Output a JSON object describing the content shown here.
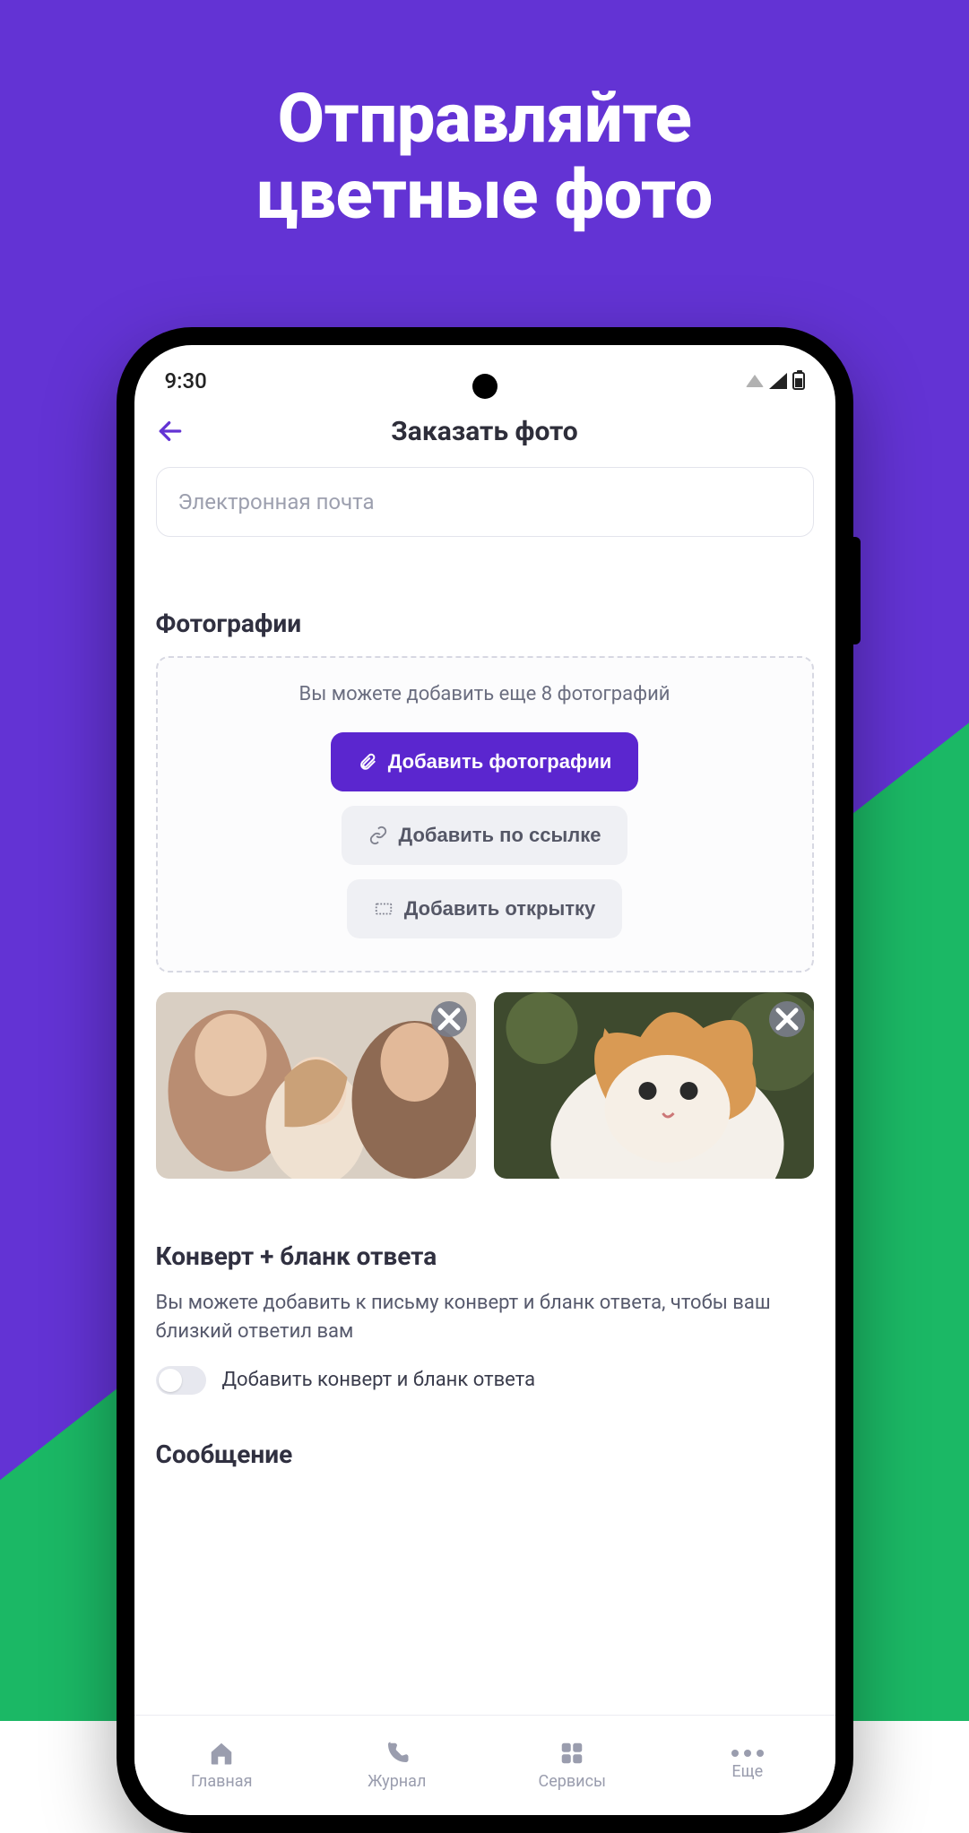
{
  "promo": {
    "line1": "Отправляйте",
    "line2": "цветные фото"
  },
  "statusbar": {
    "time": "9:30"
  },
  "header": {
    "title": "Заказать фото"
  },
  "email": {
    "placeholder": "Электронная почта"
  },
  "photos": {
    "title": "Фотографии",
    "hint": "Вы можете добавить еще 8 фотографий",
    "add_button": "Добавить фотографии",
    "add_link_button": "Добавить по ссылке",
    "add_card_button": "Добавить открытку"
  },
  "envelope": {
    "title": "Конверт + бланк ответа",
    "desc": "Вы можете добавить к письму конверт и бланк ответа, чтобы ваш близкий ответил вам",
    "toggle_label": "Добавить конверт и бланк ответа"
  },
  "message": {
    "title": "Сообщение"
  },
  "nav": {
    "home": "Главная",
    "journal": "Журнал",
    "services": "Сервисы",
    "more": "Еще"
  }
}
